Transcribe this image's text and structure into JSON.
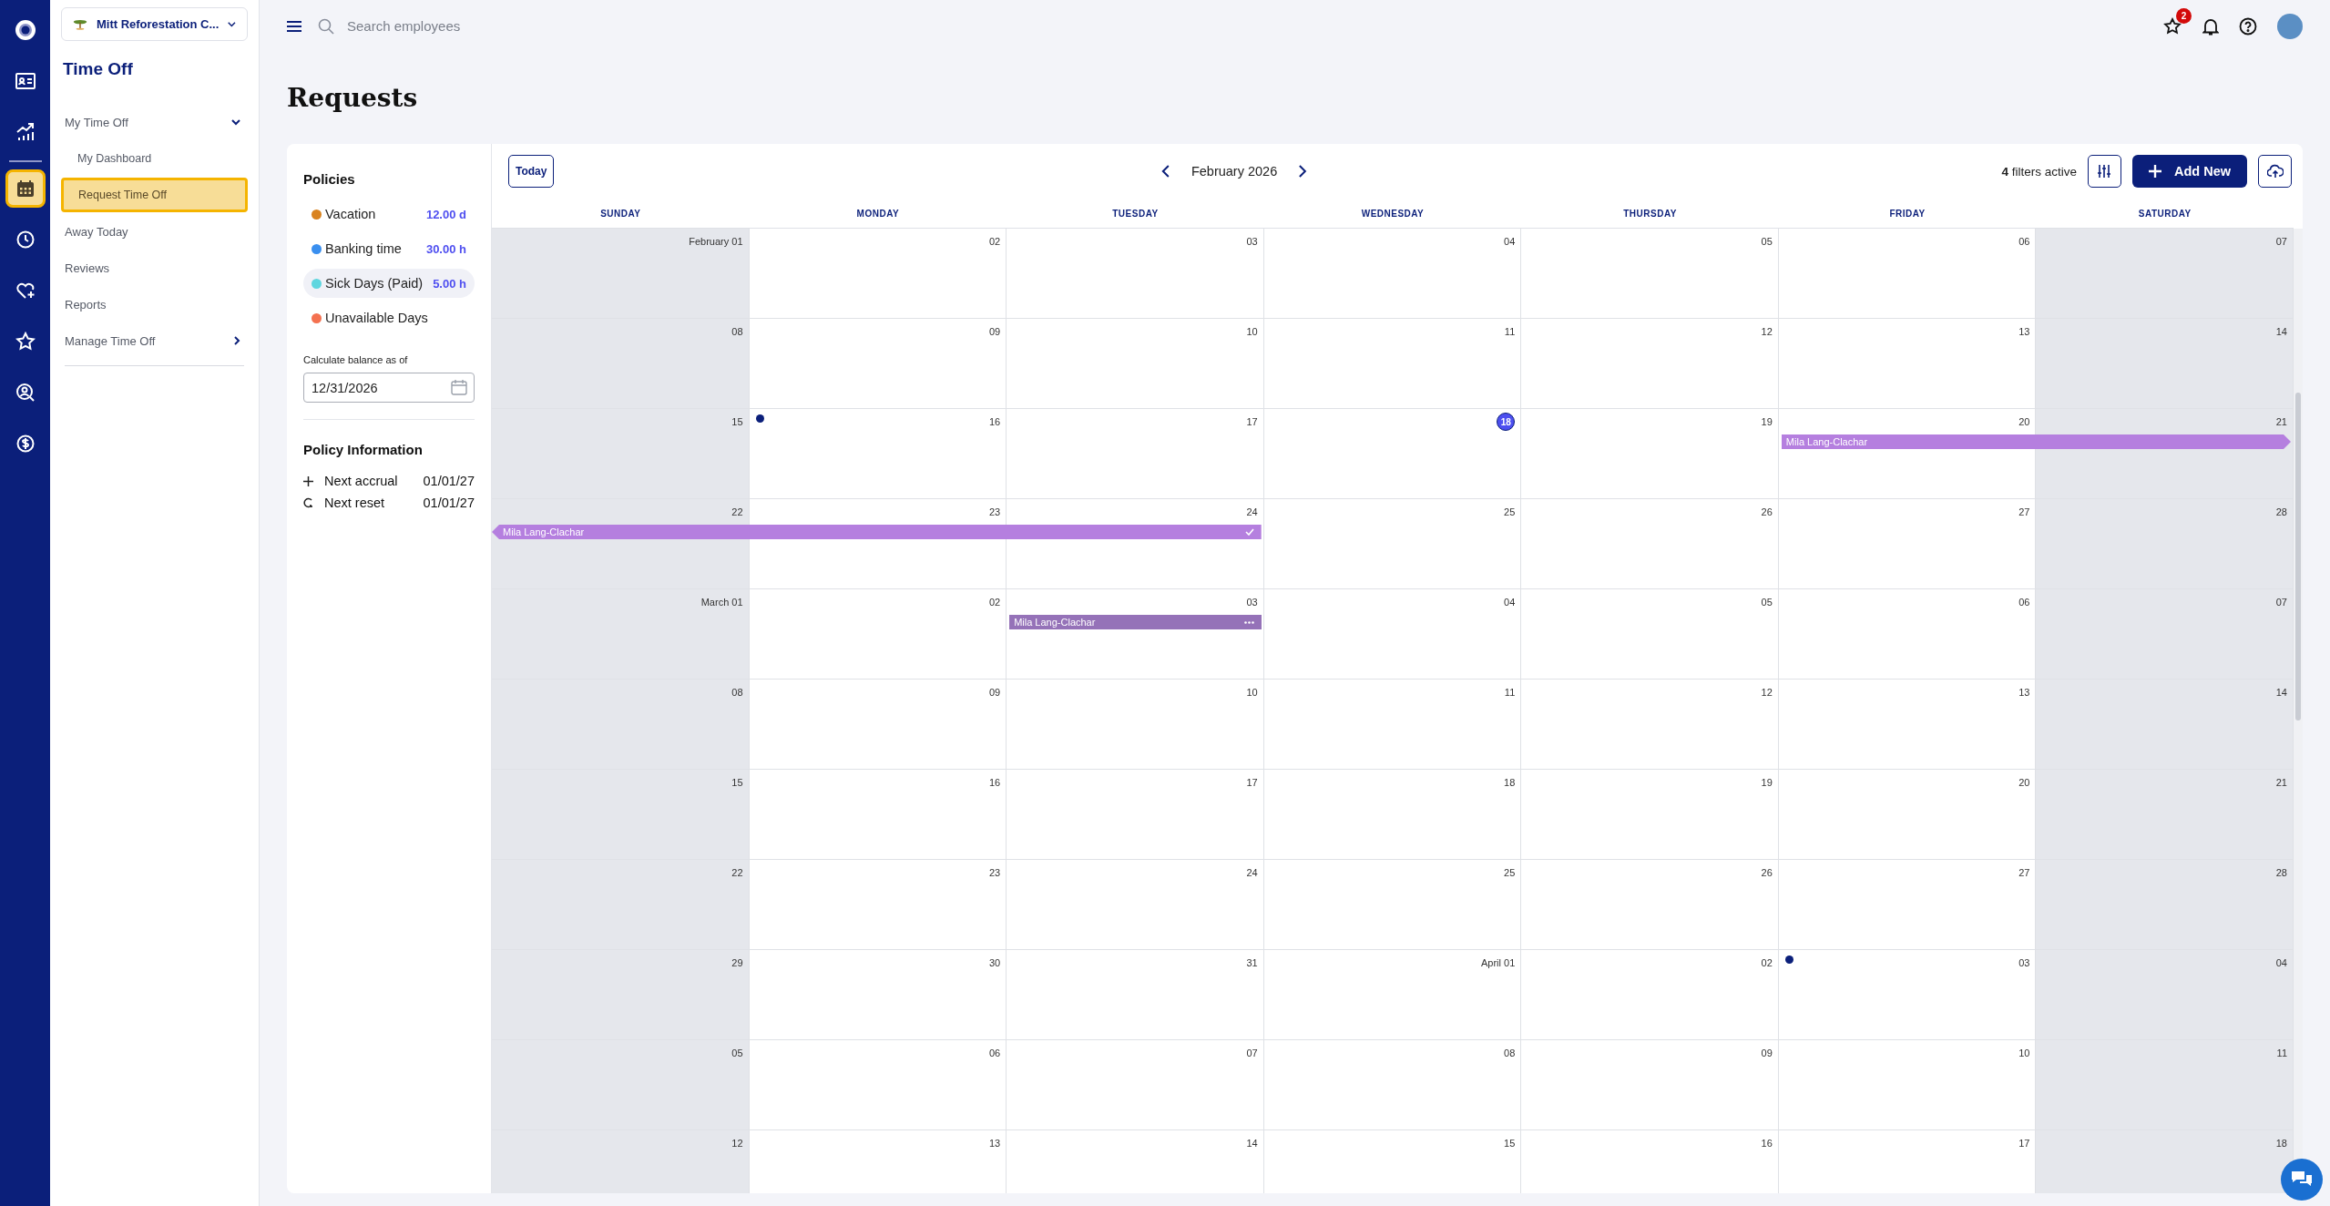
{
  "rail": [
    {
      "selected": false
    },
    {
      "selected": false
    },
    {
      "selected": false
    },
    {
      "selected": true
    },
    {
      "selected": false
    },
    {
      "selected": false
    },
    {
      "selected": false
    },
    {
      "selected": false
    },
    {
      "selected": false
    }
  ],
  "company": {
    "name": "Mitt Reforestation C..."
  },
  "sidebar": {
    "title": "Time Off",
    "items": [
      {
        "label": "My Time Off",
        "expanded": true,
        "selected": false,
        "children": [
          {
            "label": "My Dashboard",
            "selected": false
          },
          {
            "label": "Request Time Off",
            "selected": true
          }
        ]
      },
      {
        "label": "Away Today",
        "selected": false
      },
      {
        "label": "Reviews",
        "selected": false
      },
      {
        "label": "Reports",
        "selected": false
      },
      {
        "label": "Manage Time Off",
        "expanded": false,
        "selected": false
      }
    ]
  },
  "search": {
    "placeholder": "Search employees"
  },
  "topbar": {
    "badge": "2"
  },
  "page_title": "Requests",
  "policies": {
    "title": "Policies",
    "items": [
      {
        "name": "Vacation",
        "value": "12.00 d",
        "color": "#d9831f",
        "selected": false
      },
      {
        "name": "Banking time",
        "value": "30.00 h",
        "color": "#3a8fef",
        "selected": false
      },
      {
        "name": "Sick Days (Paid)",
        "value": "5.00 h",
        "color": "#5fd6df",
        "selected": true
      },
      {
        "name": "Unavailable Days",
        "color": "#f47150",
        "selected": false
      }
    ]
  },
  "balance": {
    "label": "Calculate balance as of",
    "value": "12/31/2026"
  },
  "policy_info": {
    "title": "Policy Information",
    "rows": [
      {
        "kind": "accrual",
        "label": "Next accrual",
        "value": "01/01/27"
      },
      {
        "kind": "reset",
        "label": "Next reset",
        "value": "01/01/27"
      }
    ]
  },
  "calendar": {
    "today_button": "Today",
    "month": "February 2026",
    "filters_count": "4",
    "filters_text": "filters active",
    "add_button": "Add New",
    "weekdays": [
      "SUNDAY",
      "MONDAY",
      "TUESDAY",
      "WEDNESDAY",
      "THURSDAY",
      "FRIDAY",
      "SATURDAY"
    ],
    "weeks": [
      {
        "days": [
          {
            "label": "February 01",
            "today": false,
            "marker": false
          },
          {
            "label": "02",
            "today": false,
            "marker": false
          },
          {
            "label": "03",
            "today": false,
            "marker": false
          },
          {
            "label": "04",
            "today": false,
            "marker": false
          },
          {
            "label": "05",
            "today": false,
            "marker": false
          },
          {
            "label": "06",
            "today": false,
            "marker": false
          },
          {
            "label": "07",
            "today": false,
            "marker": false
          }
        ]
      },
      {
        "days": [
          {
            "label": "08",
            "today": false,
            "marker": false
          },
          {
            "label": "09",
            "today": false,
            "marker": false
          },
          {
            "label": "10",
            "today": false,
            "marker": false
          },
          {
            "label": "11",
            "today": false,
            "marker": false
          },
          {
            "label": "12",
            "today": false,
            "marker": false
          },
          {
            "label": "13",
            "today": false,
            "marker": false
          },
          {
            "label": "14",
            "today": false,
            "marker": false
          }
        ]
      },
      {
        "days": [
          {
            "label": "15",
            "today": false,
            "marker": false
          },
          {
            "label": "16",
            "today": false,
            "marker": true
          },
          {
            "label": "17",
            "today": false,
            "marker": false
          },
          {
            "label": "18",
            "today": true,
            "marker": false
          },
          {
            "label": "19",
            "today": false,
            "marker": false
          },
          {
            "label": "20",
            "today": false,
            "marker": false,
            "event": {
              "name": "Mila Lang-Clachar",
              "kind": "plain",
              "continues_before": false,
              "continues_after": true,
              "color": "#b57fdf"
            }
          },
          {
            "label": "21",
            "today": false,
            "marker": false
          }
        ]
      },
      {
        "days": [
          {
            "label": "22",
            "today": false,
            "marker": false
          },
          {
            "label": "23",
            "today": false,
            "marker": false
          },
          {
            "label": "24",
            "today": false,
            "marker": false,
            "event": {
              "name": "Mila Lang-Clachar",
              "kind": "approved",
              "continues_before": true,
              "continues_after": false,
              "color": "#b57fdf"
            }
          },
          {
            "label": "25",
            "today": false,
            "marker": false
          },
          {
            "label": "26",
            "today": false,
            "marker": false
          },
          {
            "label": "27",
            "today": false,
            "marker": false
          },
          {
            "label": "28",
            "today": false,
            "marker": false
          }
        ]
      },
      {
        "days": [
          {
            "label": "March 01",
            "today": false,
            "marker": false
          },
          {
            "label": "02",
            "today": false,
            "marker": false
          },
          {
            "label": "03",
            "today": false,
            "marker": false,
            "event": {
              "name": "Mila Lang-Clachar",
              "kind": "pending",
              "continues_before": false,
              "continues_after": false,
              "color": "#9572b8"
            }
          },
          {
            "label": "04",
            "today": false,
            "marker": false
          },
          {
            "label": "05",
            "today": false,
            "marker": false
          },
          {
            "label": "06",
            "today": false,
            "marker": false
          },
          {
            "label": "07",
            "today": false,
            "marker": false
          }
        ]
      },
      {
        "days": [
          {
            "label": "08",
            "today": false,
            "marker": false
          },
          {
            "label": "09",
            "today": false,
            "marker": false
          },
          {
            "label": "10",
            "today": false,
            "marker": false
          },
          {
            "label": "11",
            "today": false,
            "marker": false
          },
          {
            "label": "12",
            "today": false,
            "marker": false
          },
          {
            "label": "13",
            "today": false,
            "marker": false
          },
          {
            "label": "14",
            "today": false,
            "marker": false
          }
        ]
      },
      {
        "days": [
          {
            "label": "15",
            "today": false,
            "marker": false
          },
          {
            "label": "16",
            "today": false,
            "marker": false
          },
          {
            "label": "17",
            "today": false,
            "marker": false
          },
          {
            "label": "18",
            "today": false,
            "marker": false
          },
          {
            "label": "19",
            "today": false,
            "marker": false
          },
          {
            "label": "20",
            "today": false,
            "marker": false
          },
          {
            "label": "21",
            "today": false,
            "marker": false
          }
        ]
      },
      {
        "days": [
          {
            "label": "22",
            "today": false,
            "marker": false
          },
          {
            "label": "23",
            "today": false,
            "marker": false
          },
          {
            "label": "24",
            "today": false,
            "marker": false
          },
          {
            "label": "25",
            "today": false,
            "marker": false
          },
          {
            "label": "26",
            "today": false,
            "marker": false
          },
          {
            "label": "27",
            "today": false,
            "marker": false
          },
          {
            "label": "28",
            "today": false,
            "marker": false
          }
        ]
      },
      {
        "days": [
          {
            "label": "29",
            "today": false,
            "marker": false
          },
          {
            "label": "30",
            "today": false,
            "marker": false
          },
          {
            "label": "31",
            "today": false,
            "marker": false
          },
          {
            "label": "April 01",
            "today": false,
            "marker": false
          },
          {
            "label": "02",
            "today": false,
            "marker": false
          },
          {
            "label": "03",
            "today": false,
            "marker": true
          },
          {
            "label": "04",
            "today": false,
            "marker": false
          }
        ]
      },
      {
        "days": [
          {
            "label": "05",
            "today": false,
            "marker": false
          },
          {
            "label": "06",
            "today": false,
            "marker": false
          },
          {
            "label": "07",
            "today": false,
            "marker": false
          },
          {
            "label": "08",
            "today": false,
            "marker": false
          },
          {
            "label": "09",
            "today": false,
            "marker": false
          },
          {
            "label": "10",
            "today": false,
            "marker": false
          },
          {
            "label": "11",
            "today": false,
            "marker": false
          }
        ]
      },
      {
        "days": [
          {
            "label": "12",
            "today": false,
            "marker": false
          },
          {
            "label": "13",
            "today": false,
            "marker": false
          },
          {
            "label": "14",
            "today": false,
            "marker": false
          },
          {
            "label": "15",
            "today": false,
            "marker": false
          },
          {
            "label": "16",
            "today": false,
            "marker": false
          },
          {
            "label": "17",
            "today": false,
            "marker": false
          },
          {
            "label": "18",
            "today": false,
            "marker": false
          }
        ]
      }
    ]
  }
}
